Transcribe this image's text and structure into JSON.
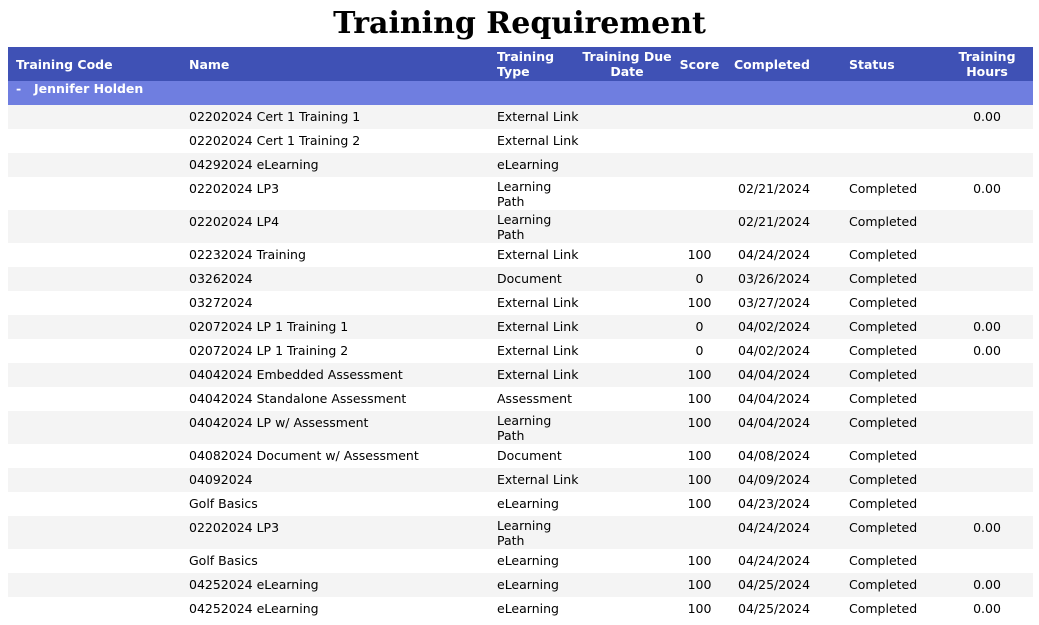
{
  "title": "Training Requirement",
  "columns": {
    "code": "Training Code",
    "name": "Name",
    "type": "Training Type",
    "due": "Training Due Date",
    "score": "Score",
    "completed": "Completed",
    "status": "Status",
    "hours": "Training Hours"
  },
  "group": {
    "toggle": "-",
    "name": "Jennifer Holden"
  },
  "rows": [
    {
      "code": "",
      "name": "02202024 Cert 1 Training 1",
      "type": "External Link",
      "due": "",
      "score": "",
      "completed": "",
      "status": "",
      "hours": "0.00"
    },
    {
      "code": "",
      "name": "02202024 Cert 1 Training 2",
      "type": "External Link",
      "due": "",
      "score": "",
      "completed": "",
      "status": "",
      "hours": ""
    },
    {
      "code": "",
      "name": "04292024 eLearning",
      "type": "eLearning",
      "due": "",
      "score": "",
      "completed": "",
      "status": "",
      "hours": ""
    },
    {
      "code": "",
      "name": "02202024 LP3",
      "type": "Learning Path",
      "due": "",
      "score": "",
      "completed": "02/21/2024",
      "status": "Completed",
      "hours": "0.00"
    },
    {
      "code": "",
      "name": "02202024 LP4",
      "type": "Learning Path",
      "due": "",
      "score": "",
      "completed": "02/21/2024",
      "status": "Completed",
      "hours": ""
    },
    {
      "code": "",
      "name": "02232024 Training",
      "type": "External Link",
      "due": "",
      "score": "100",
      "completed": "04/24/2024",
      "status": "Completed",
      "hours": ""
    },
    {
      "code": "",
      "name": "03262024",
      "type": "Document",
      "due": "",
      "score": "0",
      "completed": "03/26/2024",
      "status": "Completed",
      "hours": ""
    },
    {
      "code": "",
      "name": "03272024",
      "type": "External Link",
      "due": "",
      "score": "100",
      "completed": "03/27/2024",
      "status": "Completed",
      "hours": ""
    },
    {
      "code": "",
      "name": "02072024 LP 1 Training 1",
      "type": "External Link",
      "due": "",
      "score": "0",
      "completed": "04/02/2024",
      "status": "Completed",
      "hours": "0.00"
    },
    {
      "code": "",
      "name": "02072024 LP 1 Training 2",
      "type": "External Link",
      "due": "",
      "score": "0",
      "completed": "04/02/2024",
      "status": "Completed",
      "hours": "0.00"
    },
    {
      "code": "",
      "name": "04042024 Embedded Assessment",
      "type": "External Link",
      "due": "",
      "score": "100",
      "completed": "04/04/2024",
      "status": "Completed",
      "hours": ""
    },
    {
      "code": "",
      "name": "04042024 Standalone Assessment",
      "type": "Assessment",
      "due": "",
      "score": "100",
      "completed": "04/04/2024",
      "status": "Completed",
      "hours": ""
    },
    {
      "code": "",
      "name": "04042024 LP w/ Assessment",
      "type": "Learning Path",
      "due": "",
      "score": "100",
      "completed": "04/04/2024",
      "status": "Completed",
      "hours": ""
    },
    {
      "code": "",
      "name": "04082024 Document w/ Assessment",
      "type": "Document",
      "due": "",
      "score": "100",
      "completed": "04/08/2024",
      "status": "Completed",
      "hours": ""
    },
    {
      "code": "",
      "name": "04092024",
      "type": "External Link",
      "due": "",
      "score": "100",
      "completed": "04/09/2024",
      "status": "Completed",
      "hours": ""
    },
    {
      "code": "",
      "name": "Golf Basics",
      "type": "eLearning",
      "due": "",
      "score": "100",
      "completed": "04/23/2024",
      "status": "Completed",
      "hours": ""
    },
    {
      "code": "",
      "name": "02202024 LP3",
      "type": "Learning Path",
      "due": "",
      "score": "",
      "completed": "04/24/2024",
      "status": "Completed",
      "hours": "0.00"
    },
    {
      "code": "",
      "name": "Golf Basics",
      "type": "eLearning",
      "due": "",
      "score": "100",
      "completed": "04/24/2024",
      "status": "Completed",
      "hours": ""
    },
    {
      "code": "",
      "name": "04252024 eLearning",
      "type": "eLearning",
      "due": "",
      "score": "100",
      "completed": "04/25/2024",
      "status": "Completed",
      "hours": "0.00"
    },
    {
      "code": "",
      "name": "04252024 eLearning",
      "type": "eLearning",
      "due": "",
      "score": "100",
      "completed": "04/25/2024",
      "status": "Completed",
      "hours": "0.00"
    }
  ]
}
